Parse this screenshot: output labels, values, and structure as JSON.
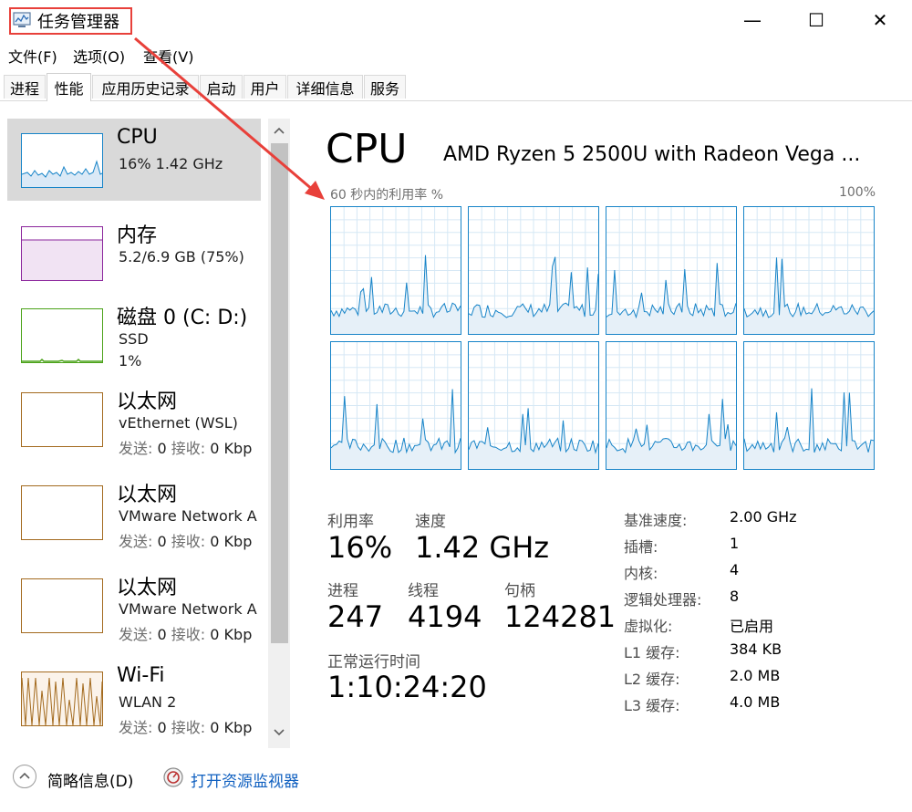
{
  "window": {
    "title": "任务管理器",
    "controls": {
      "minimize": "—",
      "maximize": "☐",
      "close": "✕"
    }
  },
  "menu": [
    "文件(F)",
    "选项(O)",
    "查看(V)"
  ],
  "tabs": [
    {
      "label": "进程",
      "active": false
    },
    {
      "label": "性能",
      "active": true
    },
    {
      "label": "应用历史记录",
      "active": false
    },
    {
      "label": "启动",
      "active": false
    },
    {
      "label": "用户",
      "active": false
    },
    {
      "label": "详细信息",
      "active": false
    },
    {
      "label": "服务",
      "active": false
    }
  ],
  "sidebar": {
    "items": [
      {
        "name": "CPU",
        "line2": "16%  1.42 GHz",
        "line3": "",
        "color": "#1784c8",
        "selected": true
      },
      {
        "name": "内存",
        "line2": "5.2/6.9 GB (75%)",
        "line3": "",
        "color": "#8b259c",
        "selected": false
      },
      {
        "name": "磁盘 0 (C: D:)",
        "line2": "SSD",
        "line3": "1%",
        "color": "#4aa218",
        "selected": false
      },
      {
        "name": "以太网",
        "line2": "vEthernet (WSL)",
        "line3_label1": "发送:",
        "line3_val1": "0",
        "line3_label2": "接收:",
        "line3_val2": "0 Kbp",
        "color": "#a36a1e",
        "selected": false
      },
      {
        "name": "以太网",
        "line2": "VMware Network A",
        "line3_label1": "发送:",
        "line3_val1": "0",
        "line3_label2": "接收:",
        "line3_val2": "0 Kbp",
        "color": "#a36a1e",
        "selected": false
      },
      {
        "name": "以太网",
        "line2": "VMware Network A",
        "line3_label1": "发送:",
        "line3_val1": "0",
        "line3_label2": "接收:",
        "line3_val2": "0 Kbp",
        "color": "#a36a1e",
        "selected": false
      },
      {
        "name": "Wi-Fi",
        "line2": "WLAN 2",
        "line3_label1": "发送:",
        "line3_val1": "0",
        "line3_label2": "接收:",
        "line3_val2": "0 Kbp",
        "color": "#a36a1e",
        "selected": false
      }
    ]
  },
  "main": {
    "title": "CPU",
    "model": "AMD Ryzen 5 2500U with Radeon Vega ...",
    "graph_label": "60 秒内的利用率 %",
    "graph_max": "100%",
    "stats": {
      "utilization_label": "利用率",
      "utilization": "16%",
      "speed_label": "速度",
      "speed": "1.42 GHz",
      "processes_label": "进程",
      "processes": "247",
      "threads_label": "线程",
      "threads": "4194",
      "handles_label": "句柄",
      "handles": "124281",
      "uptime_label": "正常运行时间",
      "uptime": "1:10:24:20"
    },
    "specs": [
      {
        "label": "基准速度:",
        "value": "2.00 GHz"
      },
      {
        "label": "插槽:",
        "value": "1"
      },
      {
        "label": "内核:",
        "value": "4"
      },
      {
        "label": "逻辑处理器:",
        "value": "8"
      },
      {
        "label": "虚拟化:",
        "value": "已启用"
      },
      {
        "label": "L1 缓存:",
        "value": "384 KB"
      },
      {
        "label": "L2 缓存:",
        "value": "2.0 MB"
      },
      {
        "label": "L3 缓存:",
        "value": "4.0 MB"
      }
    ]
  },
  "footer": {
    "fewer_details": "简略信息(D)",
    "open_monitor": "打开资源监视器"
  },
  "colors": {
    "cpu_accent": "#1784c8",
    "annotation_red": "#e8403a",
    "link": "#1060c0"
  }
}
